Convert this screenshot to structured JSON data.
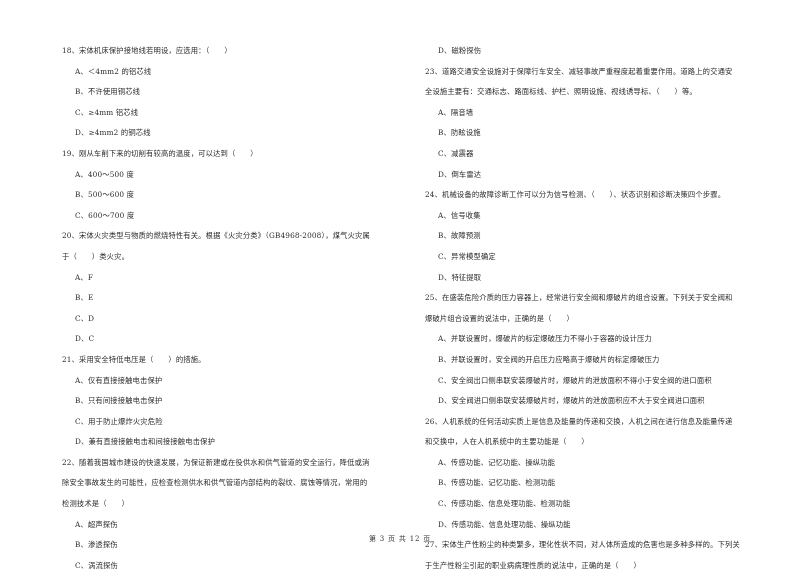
{
  "left_column": [
    {
      "type": "question",
      "text": "18、宋体机床保护接地线若明设，应选用：（　　）"
    },
    {
      "type": "option",
      "text": "A、＜4mm2 的铝芯线"
    },
    {
      "type": "option",
      "text": "B、不许使用铜芯线"
    },
    {
      "type": "option",
      "text": "C、≥4mm 铝芯线"
    },
    {
      "type": "option",
      "text": "D、≥4mm2 的铜芯线"
    },
    {
      "type": "question",
      "text": "19、刚从车削下来的切削有较高的温度，可以达到（　　）"
    },
    {
      "type": "option",
      "text": "A、400～500 度"
    },
    {
      "type": "option",
      "text": "B、500～600 度"
    },
    {
      "type": "option",
      "text": "C、600～700 度"
    },
    {
      "type": "question",
      "text": "20、宋体火灾类型与物质的燃烧特性有关。根据《火灾分类》（GB4968-2008），煤气火灾属"
    },
    {
      "type": "question",
      "text": "于（　　）类火灾。"
    },
    {
      "type": "option",
      "text": "A、F"
    },
    {
      "type": "option",
      "text": "B、E"
    },
    {
      "type": "option",
      "text": "C、D"
    },
    {
      "type": "option",
      "text": "D、C"
    },
    {
      "type": "question",
      "text": "21、采用安全特低电压是（　　）的措施。"
    },
    {
      "type": "option",
      "text": "A、仅有直接接触电击保护"
    },
    {
      "type": "option",
      "text": "B、只有间接接触电击保护"
    },
    {
      "type": "option",
      "text": "C、用于防止爆炸火灾危险"
    },
    {
      "type": "option",
      "text": "D、兼有直接接触电击和间接接触电击保护"
    },
    {
      "type": "question",
      "text": "22、随着我国城市建设的快速发展，为保证新建或在役供水和供气管道的安全运行，降低或消"
    },
    {
      "type": "question",
      "text": "除安全事故发生的可能性，应检查检测供水和供气管道内部结构的裂纹、腐蚀等情况，常用的"
    },
    {
      "type": "question",
      "text": "检测技术是（　　）"
    },
    {
      "type": "option",
      "text": "A、超声探伤"
    },
    {
      "type": "option",
      "text": "B、渗透探伤"
    },
    {
      "type": "option",
      "text": "C、涡流探伤"
    }
  ],
  "right_column": [
    {
      "type": "option",
      "text": "D、磁粉探伤"
    },
    {
      "type": "question",
      "text": "23、道路交通安全设施对于保障行车安全、减轻事故严重程度起着重要作用。道路上的交通安"
    },
    {
      "type": "question",
      "text": "全设施主要有：交通标志、路面标线、护栏、照明设施、视线诱导标、（　　）等。"
    },
    {
      "type": "option",
      "text": "A、隔音墙"
    },
    {
      "type": "option",
      "text": "B、防眩设施"
    },
    {
      "type": "option",
      "text": "C、减震器"
    },
    {
      "type": "option",
      "text": "D、倒车雷达"
    },
    {
      "type": "question",
      "text": "24、机械设备的故障诊断工作可以分为信号检测、（　　）、状态识别和诊断决策四个步骤。"
    },
    {
      "type": "option",
      "text": "A、信号收集"
    },
    {
      "type": "option",
      "text": "B、故障预测"
    },
    {
      "type": "option",
      "text": "C、异常模型确定"
    },
    {
      "type": "option",
      "text": "D、特征提取"
    },
    {
      "type": "question",
      "text": "25、在盛装危险介质的压力容器上，经常进行安全阀和爆破片的组合设置。下列关于安全阀和"
    },
    {
      "type": "question",
      "text": "爆破片组合设置的说法中，正确的是（　　）"
    },
    {
      "type": "option",
      "text": "A、并联设置时，爆破片的标定爆破压力不得小于容器的设计压力"
    },
    {
      "type": "option",
      "text": "B、并联设置时，安全阀的开启压力应略高于爆破片的标定爆破压力"
    },
    {
      "type": "option",
      "text": "C、安全阀出口侧串联安装爆破片时，爆破片的泄放面积不得小于安全阀的进口面积"
    },
    {
      "type": "option",
      "text": "D、安全阀进口侧串联安装爆破片时，爆破片的泄放面积应不大于安全阀进口面积"
    },
    {
      "type": "question",
      "text": "26、人机系统的任何活动实质上是信息及能量的传递和交换，人机之间在进行信息及能量传递"
    },
    {
      "type": "question",
      "text": "和交换中，人在人机系统中的主要功能是（　　）"
    },
    {
      "type": "option",
      "text": "A、传感功能、记忆功能、操纵功能"
    },
    {
      "type": "option",
      "text": "B、传感功能、记忆功能、检测功能"
    },
    {
      "type": "option",
      "text": "C、传感功能、信息处理功能、检测功能"
    },
    {
      "type": "option",
      "text": "D、传感功能、信息处理功能、操纵功能"
    },
    {
      "type": "question",
      "text": "27、宋体生产性粉尘的种类繁多，理化性状不同，对人体所造成的危害也是多种多样的。下列关"
    },
    {
      "type": "question",
      "text": "于生产性粉尘引起的职业病病理性质的说法中，正确的是（　　）"
    }
  ],
  "footer": {
    "page_label": "第 3 页 共 12 页"
  }
}
